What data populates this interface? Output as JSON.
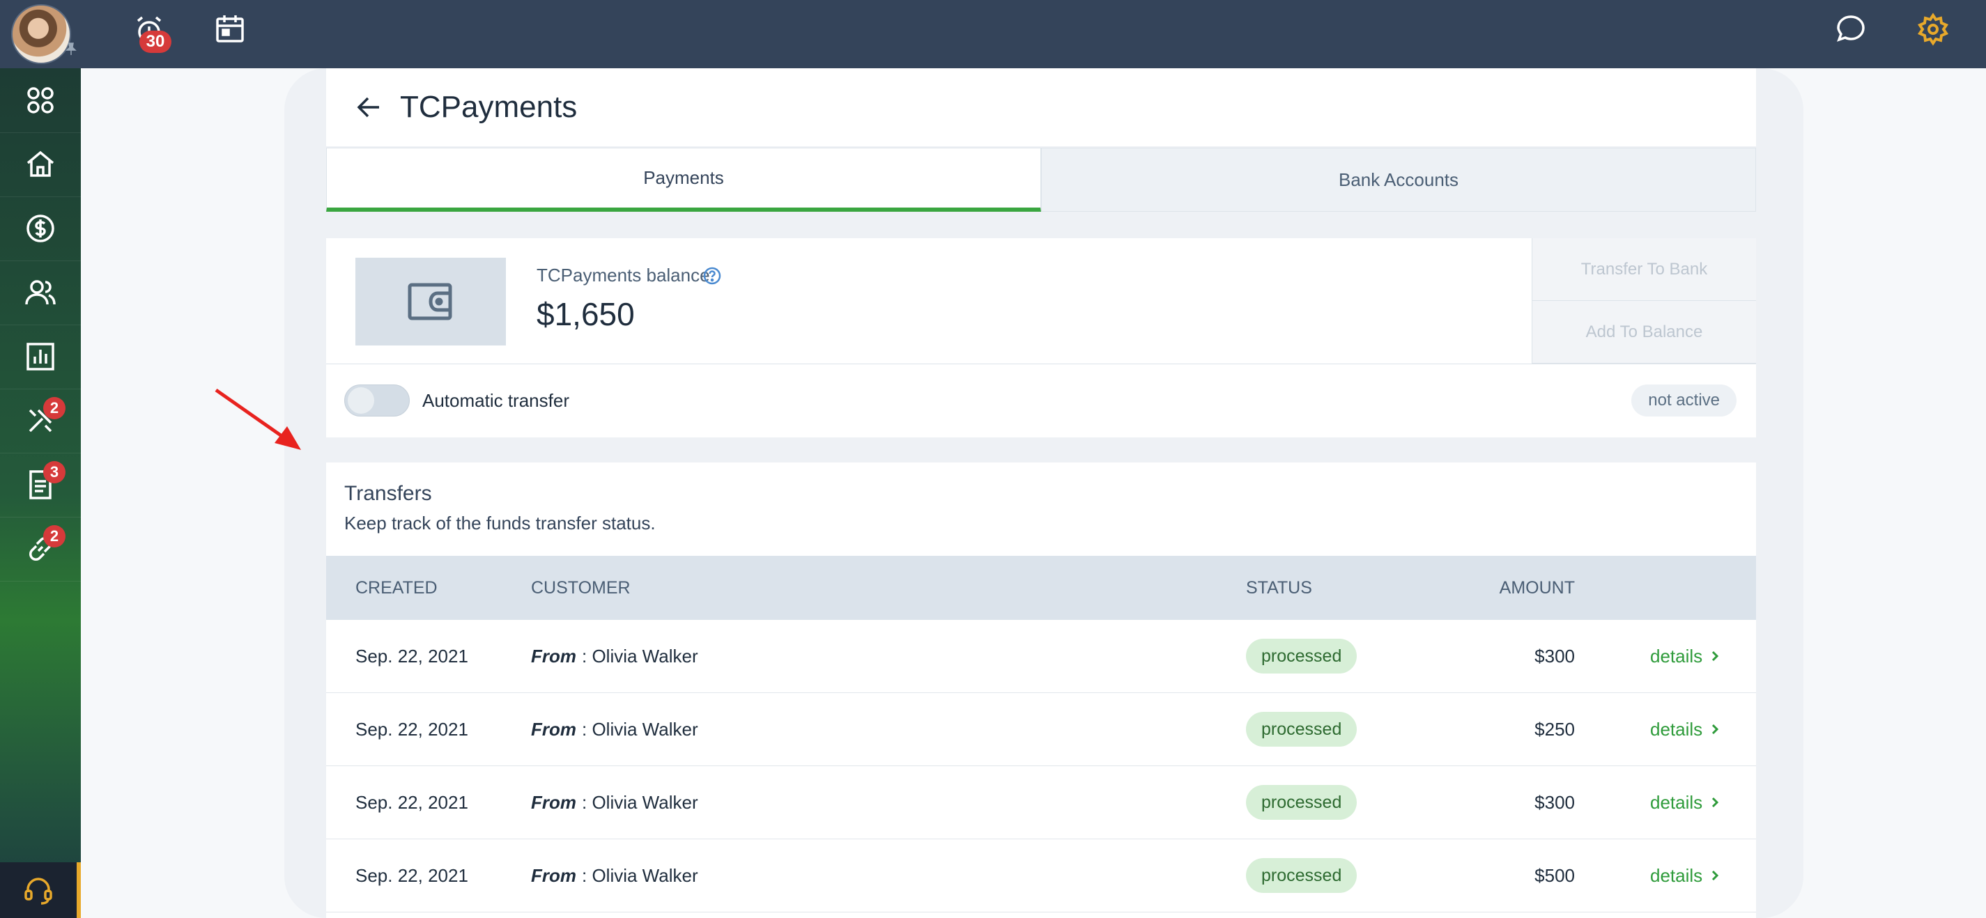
{
  "topbar": {
    "alarm_badge": "30"
  },
  "sidebar": {
    "items": [
      {
        "name": "apps",
        "badge": ""
      },
      {
        "name": "home",
        "badge": ""
      },
      {
        "name": "payments",
        "badge": ""
      },
      {
        "name": "users",
        "badge": ""
      },
      {
        "name": "reports",
        "badge": ""
      },
      {
        "name": "tools",
        "badge": "2"
      },
      {
        "name": "documents",
        "badge": "3"
      },
      {
        "name": "links",
        "badge": "2"
      }
    ]
  },
  "page": {
    "title": "TCPayments"
  },
  "tabs": [
    {
      "label": "Payments",
      "active": true
    },
    {
      "label": "Bank Accounts",
      "active": false
    }
  ],
  "balance": {
    "label": "TCPayments balance",
    "value": "$1,650",
    "transfer_button": "Transfer To Bank",
    "add_button": "Add To Balance",
    "auto_label": "Automatic transfer",
    "auto_status": "not active"
  },
  "transfers": {
    "title": "Transfers",
    "subtitle": "Keep track of the funds transfer status.",
    "columns": {
      "created": "CREATED",
      "customer": "CUSTOMER",
      "status": "STATUS",
      "amount": "AMOUNT"
    },
    "rows": [
      {
        "created": "Sep. 22, 2021",
        "from_label": "From",
        "customer": ": Olivia Walker",
        "status": "processed",
        "amount": "$300",
        "action": "details"
      },
      {
        "created": "Sep. 22, 2021",
        "from_label": "From",
        "customer": ": Olivia Walker",
        "status": "processed",
        "amount": "$250",
        "action": "details"
      },
      {
        "created": "Sep. 22, 2021",
        "from_label": "From",
        "customer": ": Olivia Walker",
        "status": "processed",
        "amount": "$300",
        "action": "details"
      },
      {
        "created": "Sep. 22, 2021",
        "from_label": "From",
        "customer": ": Olivia Walker",
        "status": "processed",
        "amount": "$500",
        "action": "details"
      }
    ]
  },
  "colors": {
    "topbar": "#34445a",
    "accent_green": "#3aa640",
    "badge_red": "#d63a3a",
    "gear_orange": "#e8a92b"
  }
}
